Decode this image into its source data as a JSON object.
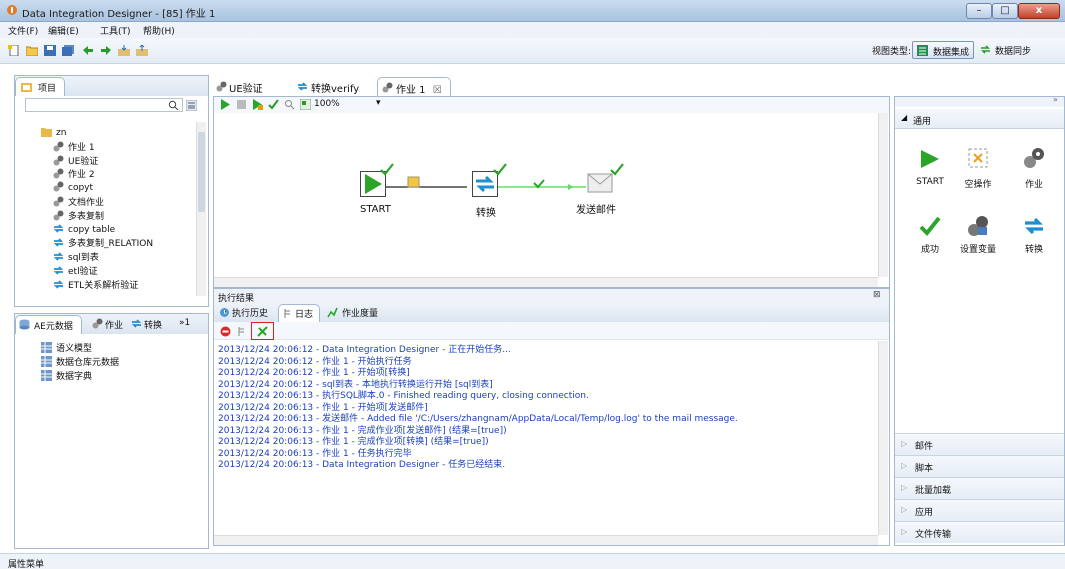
{
  "window": {
    "title": "Data Integration Designer - [85] 作业 1",
    "controls": {
      "minimize": "–",
      "maximize": "□",
      "close": "x"
    }
  },
  "menubar": [
    "文件(F)",
    "编辑(E)",
    "工具(T)",
    "帮助(H)"
  ],
  "toolbar": {
    "view_type_label": "视图类型:",
    "view_integration": "数据集成",
    "view_sync": "数据同步"
  },
  "project_panel": {
    "tab_label": "项目",
    "search_value": "",
    "tree": [
      {
        "label": "zn",
        "icon": "folder-icon"
      },
      {
        "label": "作业 1",
        "icon": "job-icon"
      },
      {
        "label": "UE验证",
        "icon": "job-icon"
      },
      {
        "label": "作业 2",
        "icon": "job-icon"
      },
      {
        "label": "copyt",
        "icon": "job-icon"
      },
      {
        "label": "文档作业",
        "icon": "job-icon"
      },
      {
        "label": "多表复制",
        "icon": "job-icon"
      },
      {
        "label": "copy table",
        "icon": "transform-icon"
      },
      {
        "label": "多表复制_RELATION",
        "icon": "transform-icon"
      },
      {
        "label": "sql到表",
        "icon": "transform-icon"
      },
      {
        "label": "etl验证",
        "icon": "transform-icon"
      },
      {
        "label": "ETL关系解析验证",
        "icon": "transform-icon"
      }
    ]
  },
  "meta_panel": {
    "tabs": [
      "AE元数据",
      "作业",
      "转换",
      "1"
    ],
    "items": [
      "语义模型",
      "数据仓库元数据",
      "数据字典"
    ]
  },
  "editor": {
    "tabs": [
      "UE验证",
      "转换verify",
      "作业 1"
    ],
    "zoom": "100%",
    "nodes": [
      {
        "label": "START",
        "icon": "start-icon"
      },
      {
        "label": "转换",
        "icon": "transform-icon"
      },
      {
        "label": "发送邮件",
        "icon": "mail-icon"
      }
    ]
  },
  "results": {
    "title": "执行结果",
    "tabs": [
      "执行历史",
      "日志",
      "作业度量"
    ],
    "log_lines": [
      "2013/12/24 20:06:12 - Data Integration Designer - 正在开始任务...",
      "2013/12/24 20:06:12 - 作业 1 - 开始执行任务",
      "2013/12/24 20:06:12 - 作业 1 - 开始项[转换]",
      "2013/12/24 20:06:12 - sql到表 - 本地执行转换运行开始 [sql到表]",
      "2013/12/24 20:06:13 - 执行SQL脚本.0 - Finished reading query, closing connection.",
      "2013/12/24 20:06:13 - 作业 1 - 开始项[发送邮件]",
      "2013/12/24 20:06:13 - 发送邮件 - Added file '/C:/Users/zhangnam/AppData/Local/Temp/log.log' to the mail message.",
      "2013/12/24 20:06:13 - 作业 1 - 完成作业项[发送邮件] (结果=[true])",
      "2013/12/24 20:06:13 - 作业 1 - 完成作业项[转换] (结果=[true])",
      "2013/12/24 20:06:13 - 作业 1 - 任务执行完毕",
      "2013/12/24 20:06:13 - Data Integration Designer - 任务已经结束."
    ]
  },
  "palette": {
    "section": "通用",
    "items": [
      {
        "label": "START",
        "icon": "start-icon"
      },
      {
        "label": "空操作",
        "icon": "dummy-icon"
      },
      {
        "label": "作业",
        "icon": "job-icon"
      },
      {
        "label": "成功",
        "icon": "success-icon"
      },
      {
        "label": "设置变量",
        "icon": "set-variable-icon"
      },
      {
        "label": "转换",
        "icon": "transform-icon"
      }
    ],
    "accordion": [
      "邮件",
      "脚本",
      "批量加载",
      "应用",
      "文件传输"
    ]
  },
  "statusbar": {
    "label": "属性菜单"
  },
  "colors": {
    "log_text": "#1a3fc0",
    "accent_green": "#2aa52a",
    "highlight_red": "#e02020"
  }
}
